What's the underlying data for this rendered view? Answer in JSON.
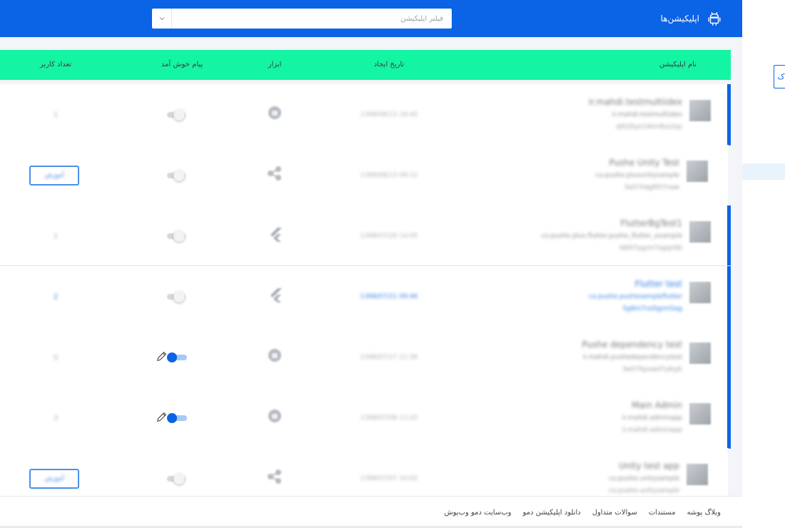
{
  "header": {
    "title": "اپلیکیشن‌ها",
    "search_placeholder": "فیلتر اپلیکیشن"
  },
  "table": {
    "headers": {
      "name": "نام اپلیکیشن",
      "date": "تاریخ ایجاد",
      "tool": "ابزار",
      "welcome": "پیام خوش آمد",
      "users": "تعداد کاربر"
    },
    "rows": [
      {
        "app_name": "ir.mahdi.testmultiidex",
        "package": "ir.mahdi.testmultiidex",
        "key": "q0t2byx14mr8sx2qs",
        "date": "1398/08/13 18:45",
        "tool": "android-icon",
        "welcome_on": false,
        "users": "1",
        "active": true,
        "highlight": false,
        "blue": false,
        "button": false
      },
      {
        "app_name": "Pushe Unity Test",
        "package": "co.pushe.plusunitysample",
        "key": "3w57tdg85l7naw",
        "date": "1398/08/13 09:12",
        "tool": "share-icon",
        "welcome_on": false,
        "users": "",
        "active": false,
        "highlight": false,
        "blue": false,
        "button": true
      },
      {
        "app_name": "FlutterBgTest1",
        "package": "co.pushe.plus.flutter.pushe_flutter_example",
        "key": "k8l07ygrm7agqn0k",
        "date": "1398/07/29 14:05",
        "tool": "flutter-icon",
        "welcome_on": false,
        "users": "1",
        "active": true,
        "highlight": false,
        "blue": false,
        "button": false
      },
      {
        "app_name": "Flutter test",
        "package": "co.pushe.pushesampleflutter",
        "key": "5g8m7vz0gzm5ag",
        "date": "1398/07/21 09:46",
        "tool": "flutter-icon",
        "welcome_on": false,
        "users": "2",
        "active": true,
        "highlight": true,
        "blue": true,
        "button": false
      },
      {
        "app_name": "Pushe dependency test",
        "package": "ir.mahdi.pushedependencytest",
        "key": "3w57bpxwd7y6yjk",
        "date": "1398/07/17 11:38",
        "tool": "android-icon",
        "welcome_on": true,
        "users": "0",
        "active": true,
        "highlight": false,
        "blue": false,
        "button": false
      },
      {
        "app_name": "Main Admin",
        "package": "ir.mahdi.adminapp",
        "key": "ir.mahdi.adminapp",
        "date": "1398/07/08 13:20",
        "tool": "android-icon",
        "welcome_on": true,
        "users": "3",
        "active": true,
        "highlight": false,
        "blue": false,
        "button": false
      },
      {
        "app_name": "Unity test app",
        "package": "co.pushe.unitysample",
        "key": "co.pushe.unitysample",
        "date": "1398/07/07 10:02",
        "tool": "share-icon",
        "welcome_on": false,
        "users": "",
        "active": false,
        "highlight": false,
        "blue": false,
        "button": true
      }
    ],
    "button_label": "آموزش"
  },
  "footer": {
    "links": [
      "وبلاگ پوشه",
      "مستندات",
      "سوالات متداول",
      "دانلود اپلیکیشن دمو",
      "وب‌سایت دمو وب‌پوش"
    ]
  },
  "side": {
    "edge_label": "ک"
  },
  "colors": {
    "primary": "#0b63e6",
    "table_header": "#14f5a3"
  }
}
